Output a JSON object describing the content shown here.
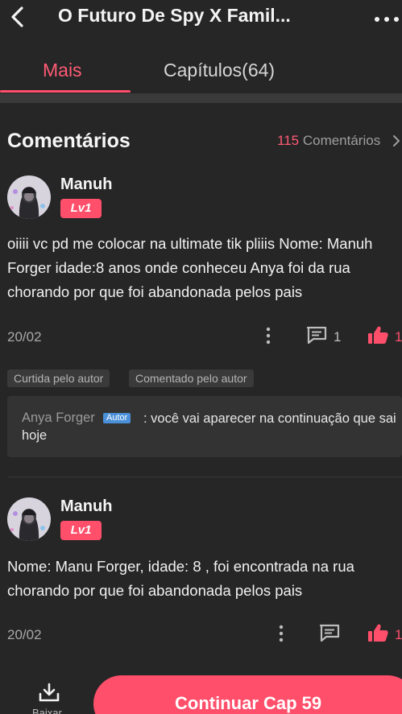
{
  "header": {
    "title": "O Futuro De Spy X Famil..."
  },
  "tabs": [
    {
      "label": "Mais",
      "active": true
    },
    {
      "label": "Capítulos(64)",
      "active": false
    }
  ],
  "comments_section": {
    "title": "Comentários",
    "count": "115",
    "count_label": " Comentários"
  },
  "comments": [
    {
      "user": "Manuh",
      "level": "Lv1",
      "text": "oiiii vc pd me colocar na ultimate tik pliiis Nome: Manuh Forger idade:8 anos onde conheceu Anya foi da rua chorando por que foi abandonada pelos pais",
      "date": "20/02",
      "reply_count": "1",
      "like_count": "1",
      "badges": [
        "Curtida pelo autor",
        "Comentado pelo autor"
      ],
      "author_reply": {
        "author": "Anya Forger",
        "tag": "Autor",
        "text": ": você vai aparecer na continuação que sai hoje"
      }
    },
    {
      "user": "Manuh",
      "level": "Lv1",
      "text": "Nome: Manu Forger, idade: 8 , foi encontrada na rua chorando por que foi abandonada pelos pais",
      "date": "20/02",
      "like_count": "1"
    }
  ],
  "bottom_bar": {
    "download_label": "Baixar",
    "cta_label": "Continuar Cap 59"
  },
  "colors": {
    "accent": "#ff4f6b",
    "background": "#262626",
    "author_tag": "#4a90d9"
  },
  "icons": [
    "back-arrow-icon",
    "more-dots-icon",
    "chevron-right-icon",
    "kebab-icon",
    "comment-icon",
    "thumbs-up-icon",
    "download-icon"
  ]
}
